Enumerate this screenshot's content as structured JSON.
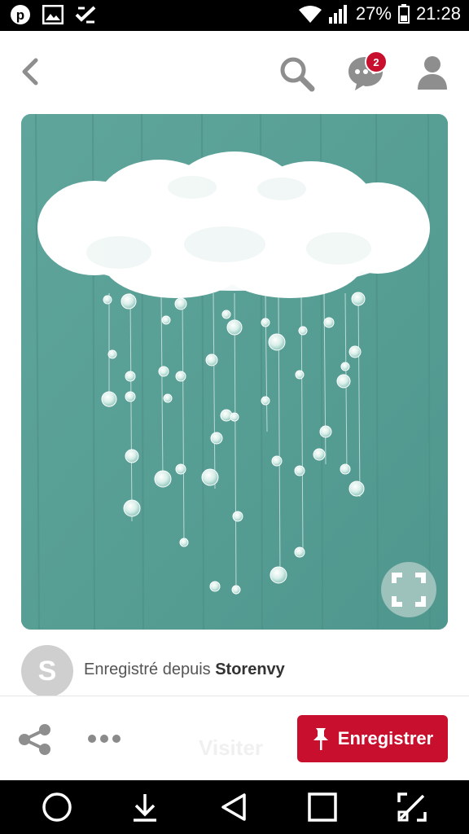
{
  "status_bar": {
    "battery": "27%",
    "time": "21:28",
    "left_icons": [
      "pinterest-icon",
      "gallery-icon",
      "checklist-icon"
    ],
    "right_icons": [
      "wifi-icon",
      "signal-icon",
      "battery-icon"
    ]
  },
  "header": {
    "icons": [
      "back-icon",
      "search-icon",
      "messages-icon",
      "profile-icon"
    ],
    "messages_badge": "2"
  },
  "pin": {
    "subject": "white tulle cloud mobile with crystal raindrops on teal wall",
    "background_color": "#5fa39a",
    "zoom_icon": "fullscreen-icon"
  },
  "source": {
    "avatar_letter": "S",
    "prefix": "Enregistré depuis",
    "name": "Storenvy"
  },
  "actions": {
    "share_icon": "share-icon",
    "more_icon": "more-icon",
    "ghost_label": "Visiter",
    "save_label": "Enregistrer",
    "accent": "#c8102e"
  },
  "nav_bar": {
    "icons": [
      "home-circle-icon",
      "download-icon",
      "back-triangle-icon",
      "recent-square-icon",
      "resize-icon"
    ]
  }
}
